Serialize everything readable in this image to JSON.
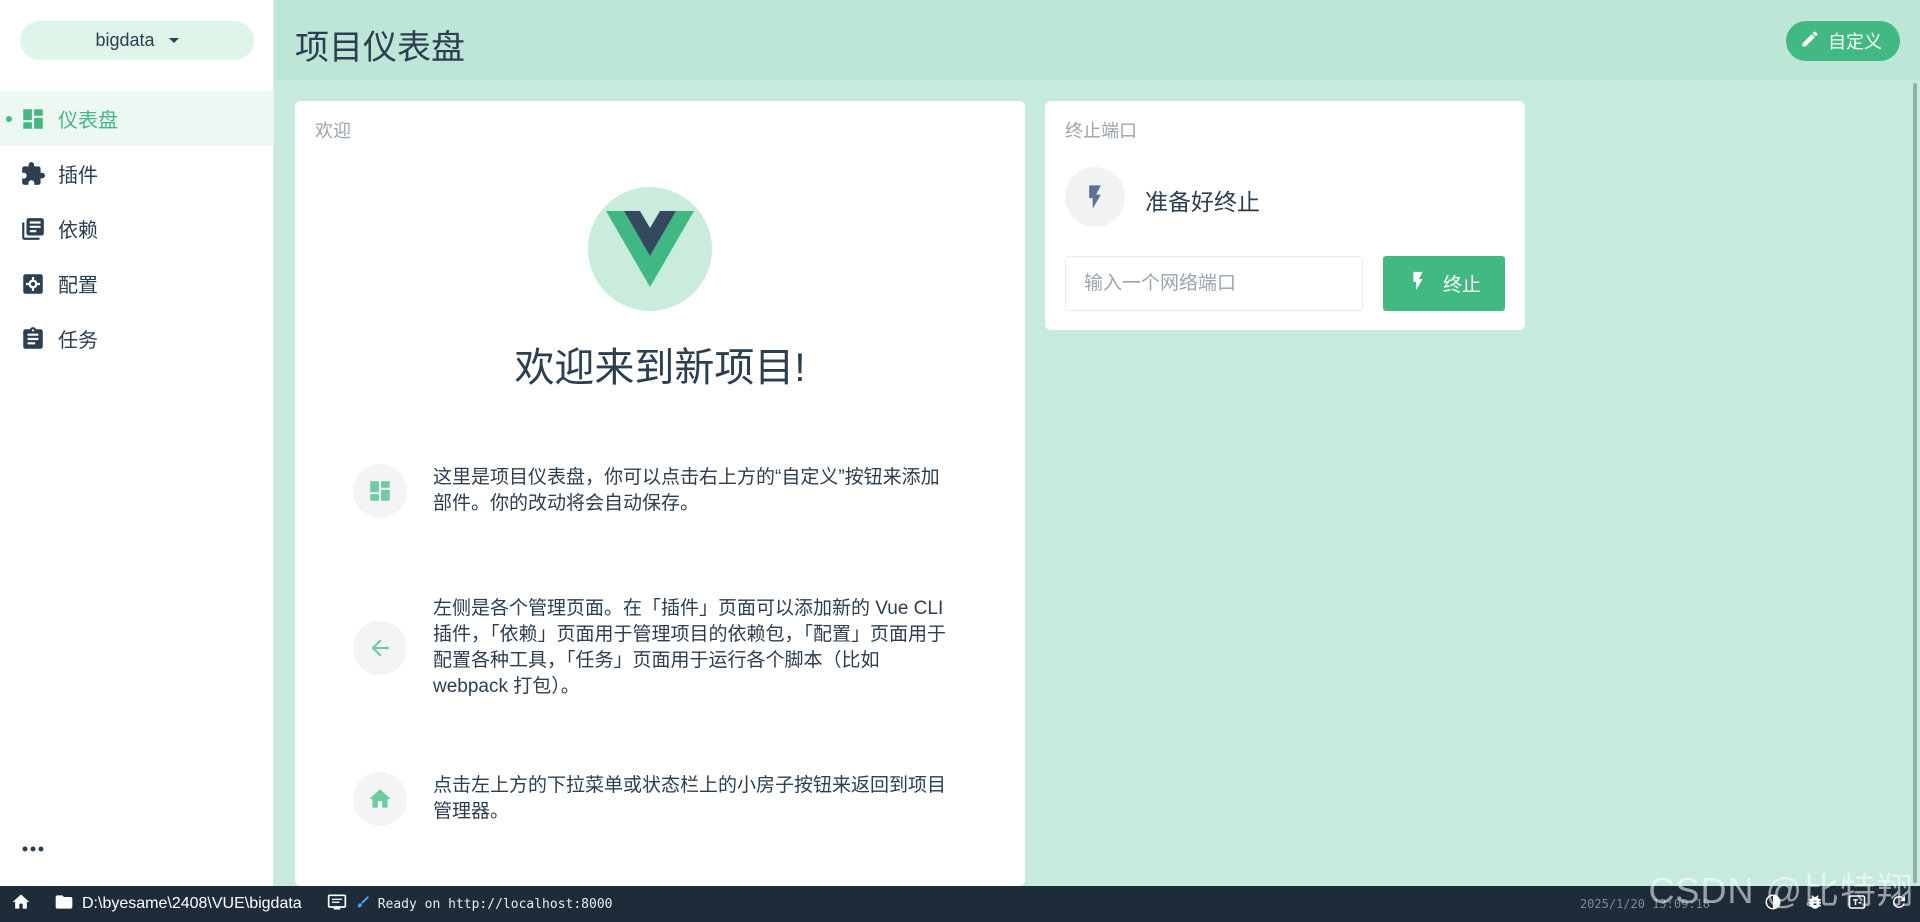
{
  "sidebar": {
    "project_name": "bigdata",
    "items": [
      {
        "label": "仪表盘",
        "icon": "dashboard-icon",
        "active": true
      },
      {
        "label": "插件",
        "icon": "puzzle-icon",
        "active": false
      },
      {
        "label": "依赖",
        "icon": "library-books-icon",
        "active": false
      },
      {
        "label": "配置",
        "icon": "settings-icon",
        "active": false
      },
      {
        "label": "任务",
        "icon": "assignment-icon",
        "active": false
      }
    ],
    "more_icon": "more-horizontal-icon"
  },
  "header": {
    "title": "项目仪表盘",
    "customize_label": "自定义",
    "customize_icon": "edit-icon"
  },
  "welcome": {
    "card_title": "欢迎",
    "heading": "欢迎来到新项目!",
    "tips": [
      {
        "icon": "dashboard-icon",
        "text": "这里是项目仪表盘，你可以点击右上方的“自定义”按钮来添加部件。你的改动将会自动保存。"
      },
      {
        "icon": "arrow-back-icon",
        "text": "左侧是各个管理页面。在「插件」页面可以添加新的 Vue CLI 插件，「依赖」页面用于管理项目的依赖包，「配置」页面用于配置各种工具，「任务」页面用于运行各个脚本（比如 webpack 打包）。"
      },
      {
        "icon": "home-icon",
        "text": "点击左上方的下拉菜单或状态栏上的小房子按钮来返回到项目管理器。"
      }
    ]
  },
  "killport": {
    "card_title": "终止端口",
    "status": "准备好终止",
    "input_placeholder": "输入一个网络端口",
    "input_value": "",
    "button_label": "终止"
  },
  "statusbar": {
    "path": "D:\\byesame\\2408\\VUE\\bigdata",
    "message": "Ready on http://localhost:8000",
    "time": "2025/1/20 13:09:18"
  },
  "watermark": "CSDN @比特翔",
  "colors": {
    "accent": "#42b983",
    "header_bg": "#bde6d6",
    "main_bg": "#c6ebdc",
    "text": "#2c3e50",
    "statusbar_bg": "#1e2c39"
  }
}
